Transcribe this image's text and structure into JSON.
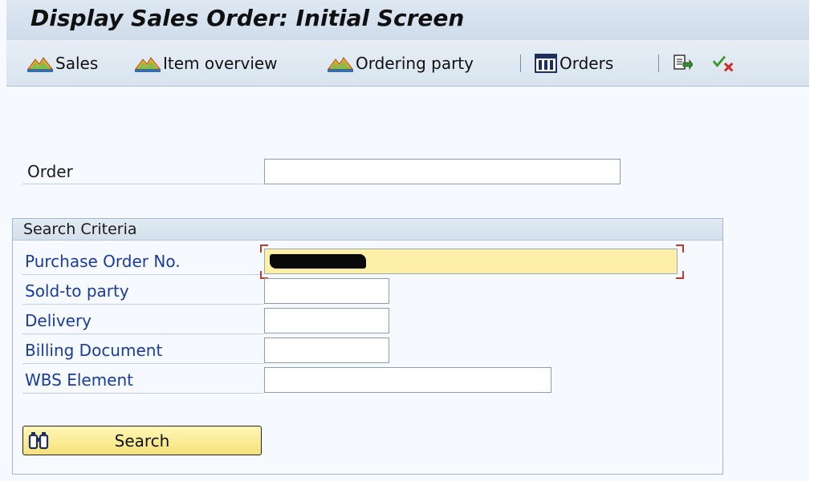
{
  "window": {
    "title": "Display Sales Order: Initial Screen"
  },
  "toolbar": {
    "sales_label": "Sales",
    "item_overview_label": "Item overview",
    "ordering_party_label": "Ordering party",
    "orders_label": "Orders"
  },
  "form": {
    "order_label": "Order",
    "order_value": ""
  },
  "search_criteria": {
    "title": "Search Criteria",
    "fields": [
      {
        "label": "Purchase Order No.",
        "value": ""
      },
      {
        "label": "Sold-to party",
        "value": ""
      },
      {
        "label": "Delivery",
        "value": ""
      },
      {
        "label": "Billing Document",
        "value": ""
      },
      {
        "label": "WBS Element",
        "value": ""
      }
    ],
    "search_button_label": "Search"
  },
  "icons": {
    "sales": "mountain-chart-icon",
    "item_overview": "mountain-chart-icon",
    "ordering_party": "mountain-chart-icon",
    "orders": "columns-list-icon",
    "export": "export-document-icon",
    "check": "check-cancel-icon",
    "search": "binoculars-icon"
  },
  "colors": {
    "focus_field": "#fdf0a6",
    "search_button": "#f6e27a",
    "label_blue": "#1a3c9a"
  }
}
